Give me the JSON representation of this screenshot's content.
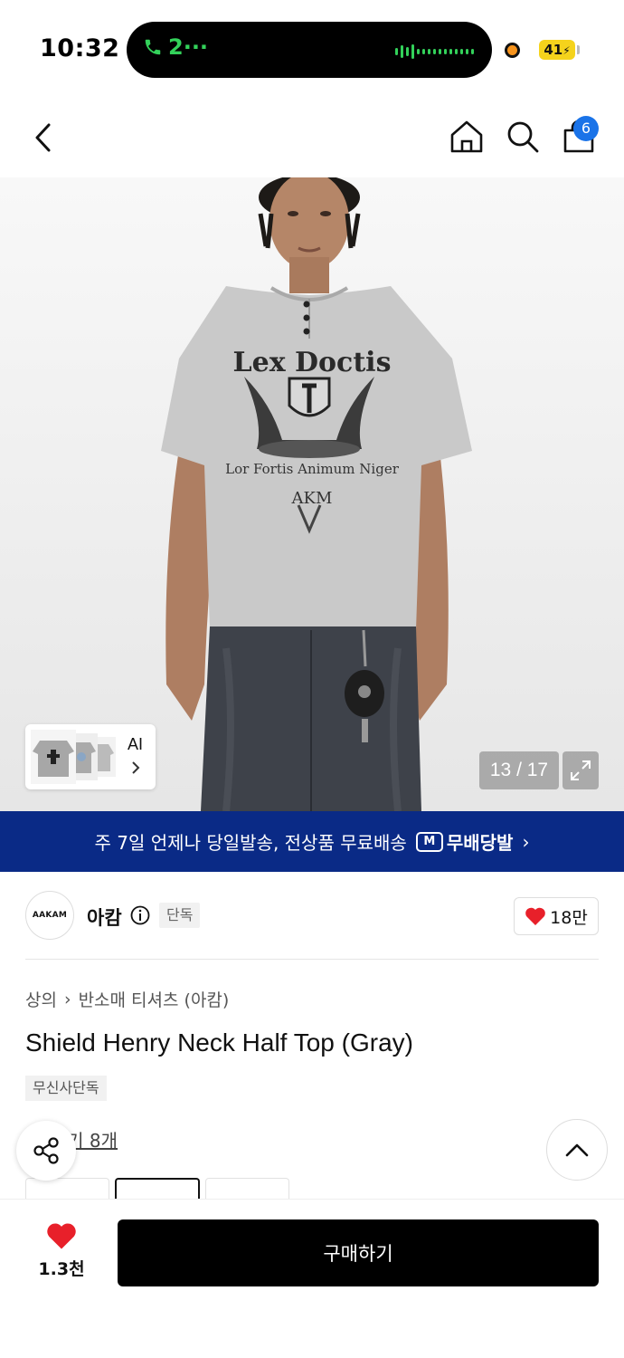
{
  "status_bar": {
    "time": "10:32",
    "call_label": "2···",
    "battery": "41"
  },
  "nav": {
    "cart_count": "6"
  },
  "gallery": {
    "ai_label": "AI",
    "counter": "13 / 17"
  },
  "banner": {
    "text": "주 7일 언제나 당일발송, 전상품 무료배송",
    "badge_icon": "M",
    "badge_text": "무배당발",
    "chevron": "›"
  },
  "brand": {
    "logo_text": "AAKAM",
    "name": "아캄",
    "tag": "단독",
    "likes": "18만"
  },
  "product": {
    "breadcrumb": [
      "상의",
      "반소매 티셔츠 (아캄)"
    ],
    "breadcrumb_sep": "›",
    "title": "Shield Henry Neck Half Top (Gray)",
    "tag": "무신사단독",
    "review_label": "후기 8개"
  },
  "bottom_bar": {
    "wish_count": "1.3천",
    "buy_label": "구매하기"
  },
  "colors": {
    "banner_bg": "#0a2a86",
    "badge_blue": "#1a73e8",
    "heart_red": "#e8202a",
    "buy_bg": "#000000"
  }
}
